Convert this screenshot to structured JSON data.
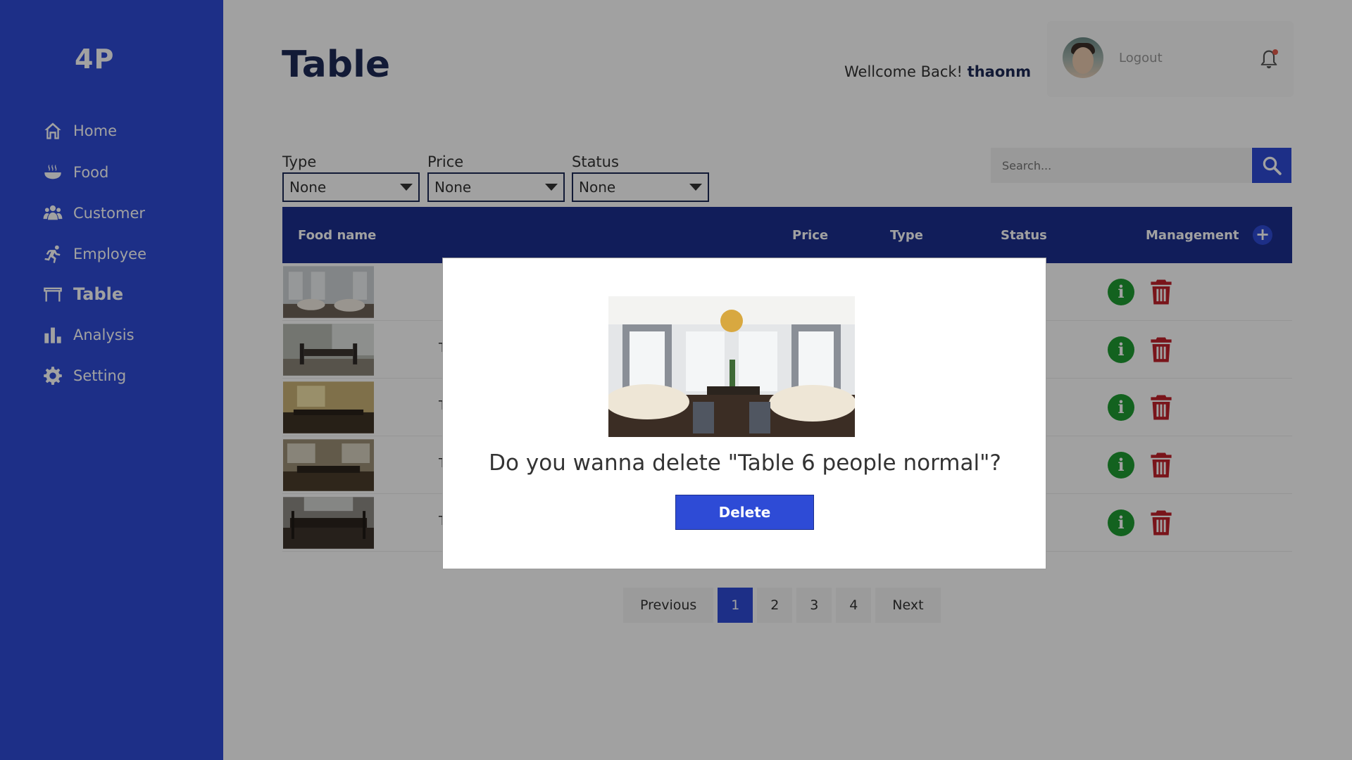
{
  "app": {
    "logo": "4P"
  },
  "sidebar": {
    "items": [
      {
        "label": "Home",
        "icon": "home-icon"
      },
      {
        "label": "Food",
        "icon": "food-bowl-icon"
      },
      {
        "label": "Customer",
        "icon": "users-icon"
      },
      {
        "label": "Employee",
        "icon": "running-person-icon"
      },
      {
        "label": "Table",
        "icon": "table-icon",
        "active": true
      },
      {
        "label": "Analysis",
        "icon": "bar-chart-icon"
      },
      {
        "label": "Setting",
        "icon": "gear-icon"
      }
    ]
  },
  "header": {
    "title": "Table",
    "welcome_prefix": "Wellcome Back!",
    "username": "thaonm",
    "logout_label": "Logout"
  },
  "filters": [
    {
      "label": "Type",
      "value": "None"
    },
    {
      "label": "Price",
      "value": "None"
    },
    {
      "label": "Status",
      "value": "None"
    }
  ],
  "search": {
    "placeholder": "Search..."
  },
  "table": {
    "columns": [
      "Food name",
      "Price",
      "Type",
      "Status",
      "Management"
    ],
    "rows": [
      {
        "name": ""
      },
      {
        "name": "T"
      },
      {
        "name": "T"
      },
      {
        "name": "T"
      },
      {
        "name": "T"
      }
    ]
  },
  "pagination": {
    "previous": "Previous",
    "pages": [
      "1",
      "2",
      "3",
      "4"
    ],
    "current": "1",
    "next": "Next"
  },
  "modal": {
    "question": "Do you wanna delete \"Table 6 people normal\"?",
    "delete_label": "Delete"
  },
  "colors": {
    "primary": "#2e4bd6",
    "header_dark": "#1b2f8f",
    "info_green": "#1f9b32",
    "delete_red": "#c0202a"
  }
}
